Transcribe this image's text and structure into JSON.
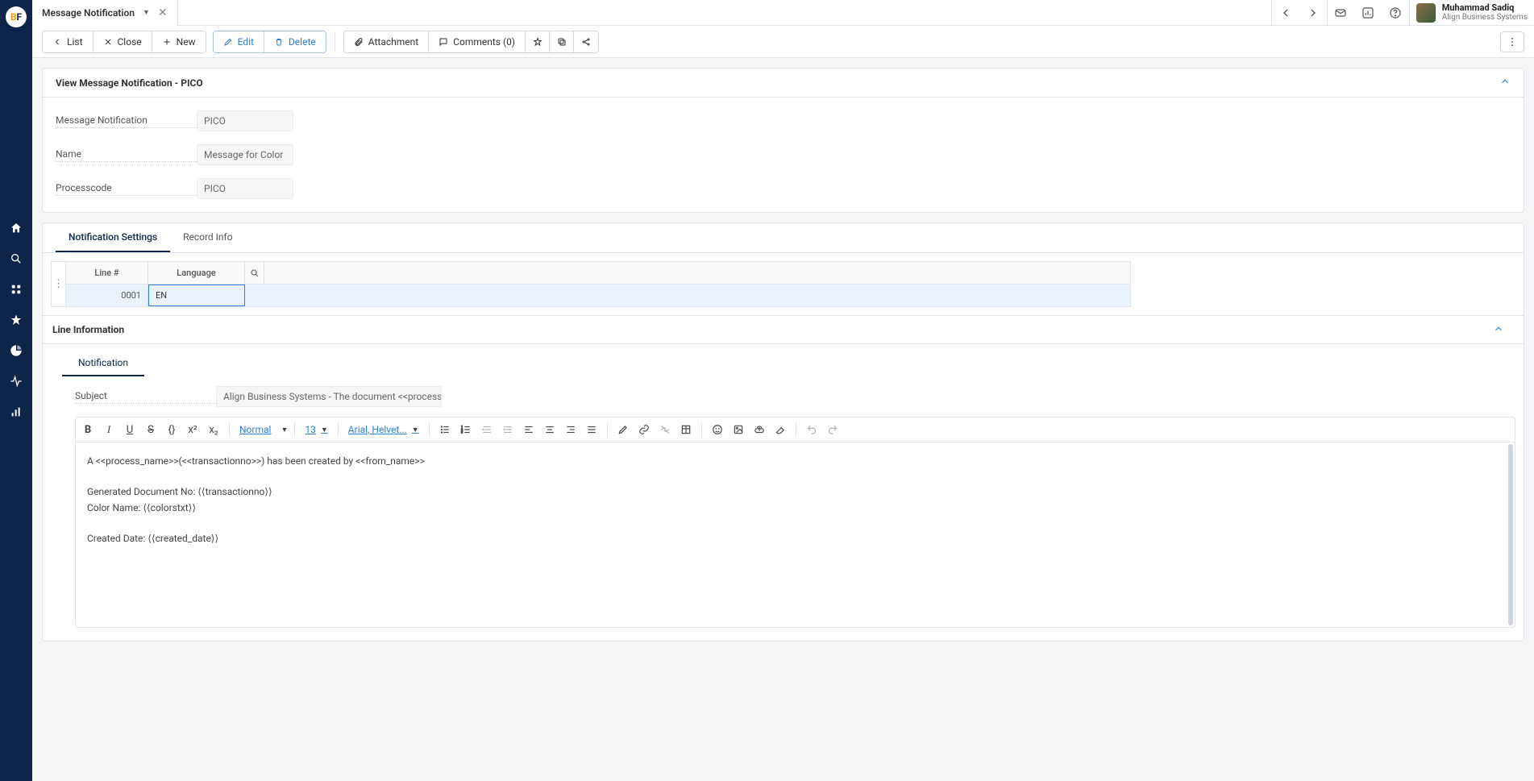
{
  "logo": {
    "b": "B",
    "f": "F"
  },
  "tab": {
    "title": "Message Notification"
  },
  "user": {
    "name": "Muhammad Sadiq",
    "org": "Align Business Systems"
  },
  "toolbar": {
    "list": "List",
    "close": "Close",
    "new": "New",
    "edit": "Edit",
    "delete": "Delete",
    "attachment": "Attachment",
    "comments": "Comments (0)"
  },
  "panel": {
    "title": "View Message Notification - PICO",
    "fields": {
      "msg_notif_label": "Message Notification",
      "msg_notif_value": "PICO",
      "name_label": "Name",
      "name_value": "Message for Color",
      "processcode_label": "Processcode",
      "processcode_value": "PICO"
    }
  },
  "tabs": {
    "settings": "Notification Settings",
    "record": "Record Info"
  },
  "grid": {
    "headers": {
      "line": "Line #",
      "language": "Language"
    },
    "row": {
      "line": "0001",
      "language": "EN"
    }
  },
  "line_info": {
    "title": "Line Information"
  },
  "sub_tab": {
    "notification": "Notification"
  },
  "subject": {
    "label": "Subject",
    "value": "Align Business Systems - The document <<process_name>>"
  },
  "editor": {
    "format": "Normal",
    "size": "13",
    "font": "Arial, Helvet...",
    "body_line1": "A <<process_name>>(<<transactionno>>) has been created by <<from_name>>",
    "body_line2": "Generated Document No: ⟨⟨transactionno⟩⟩",
    "body_line3": "Color Name: ⟨⟨colorstxt⟩⟩",
    "body_line4": "Created Date: ⟨⟨created_date⟩⟩"
  }
}
